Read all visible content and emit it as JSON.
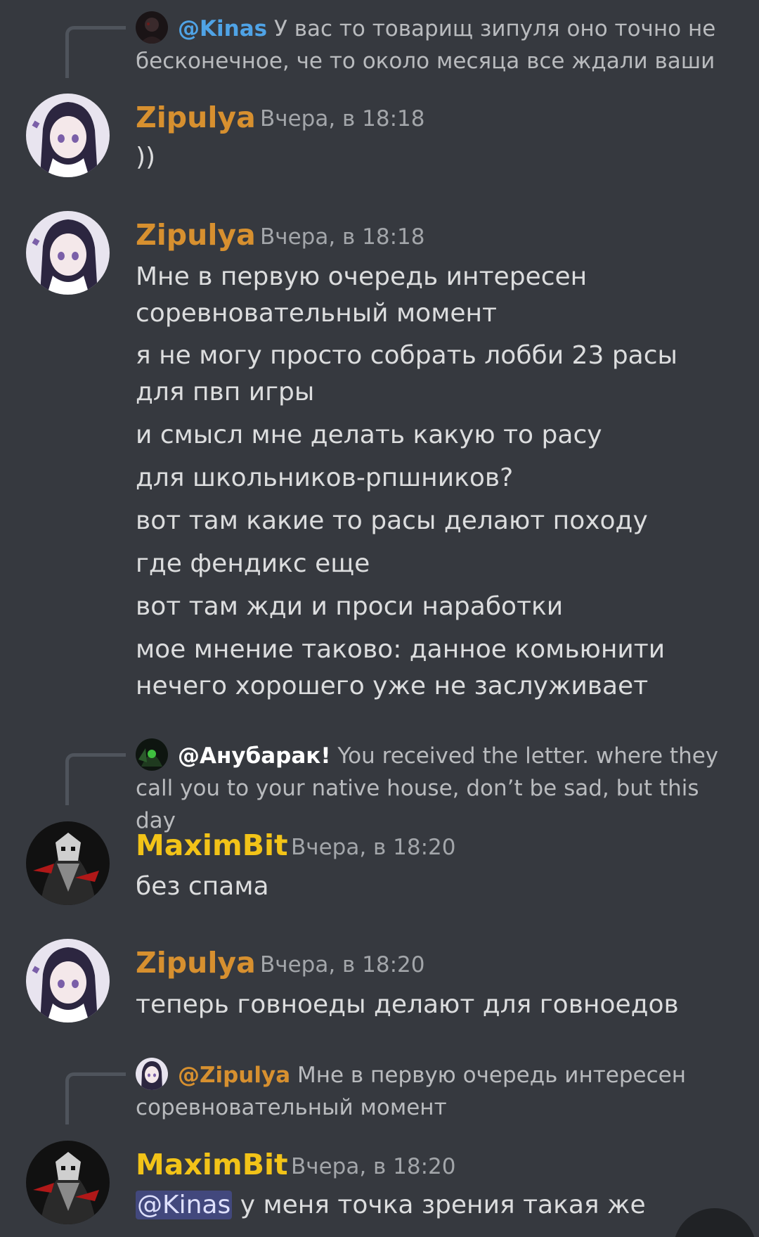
{
  "colors": {
    "zipulya": "#d7902f",
    "maximbit": "#f2c318",
    "kinas_mention": "#4fa3e6",
    "anubarak_mention": "#ffffff"
  },
  "messages": [
    {
      "reply": {
        "mention": "@Kinas",
        "text": "У вас то товарищ зипуля оно точно не бесконечное, че то около месяца все ждали ваши"
      }
    },
    {
      "author": "Zipulya",
      "time": "Вчера, в 18:18",
      "lines": [
        "))"
      ]
    },
    {
      "author": "Zipulya",
      "time": "Вчера, в 18:18",
      "lines": [
        "Мне в первую очередь интересен соревновательный момент",
        "я не могу просто собрать лобби 23 расы для пвп игры",
        "и смысл мне делать какую то расу",
        "для школьников-рпшников?",
        "вот там какие то расы делают походу",
        "где фендикс еще",
        "вот там жди и проси наработки",
        "мое мнение таково: данное комьюнити нечего хорошего уже не заслуживает"
      ]
    },
    {
      "reply": {
        "mention": "@Анубарак!",
        "text": "You received the letter. where they call you to your native house, don’t be sad, but this day"
      },
      "author": "MaximBit",
      "time": "Вчера, в 18:20",
      "lines": [
        "без спама"
      ]
    },
    {
      "author": "Zipulya",
      "time": "Вчера, в 18:20",
      "lines": [
        "теперь говноеды делают для говноедов"
      ]
    },
    {
      "reply": {
        "mention": "@Zipulya",
        "text": "Мне в первую очередь интересен соревновательный момент"
      },
      "author": "MaximBit",
      "time": "Вчера, в 18:20",
      "mention_inline": "@Kinas",
      "lines": [
        "у меня точка зрения такая же"
      ]
    }
  ]
}
